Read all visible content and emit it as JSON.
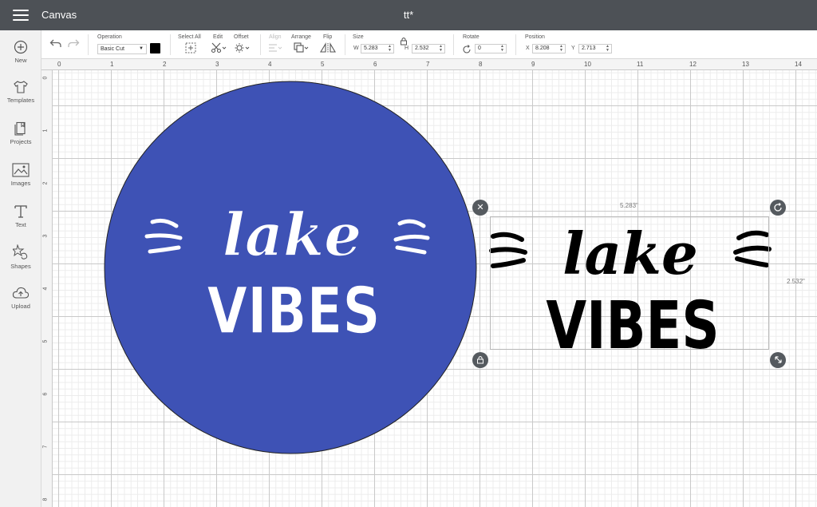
{
  "titlebar": {
    "app_title": "Canvas",
    "doc_title": "tt*"
  },
  "sidebar": {
    "items": [
      {
        "label": "New",
        "icon": "plus-circle-icon"
      },
      {
        "label": "Templates",
        "icon": "shirt-icon"
      },
      {
        "label": "Projects",
        "icon": "projects-icon"
      },
      {
        "label": "Images",
        "icon": "image-icon"
      },
      {
        "label": "Text",
        "icon": "text-icon"
      },
      {
        "label": "Shapes",
        "icon": "shapes-icon"
      },
      {
        "label": "Upload",
        "icon": "upload-icon"
      }
    ]
  },
  "toolbar": {
    "operation_label": "Operation",
    "operation_value": "Basic Cut",
    "operation_color": "#000000",
    "select_all_label": "Select All",
    "edit_label": "Edit",
    "offset_label": "Offset",
    "align_label": "Align",
    "arrange_label": "Arrange",
    "flip_label": "Flip",
    "size_label": "Size",
    "size_w_key": "W",
    "size_w": "5.283",
    "size_h_key": "H",
    "size_h": "2.532",
    "rotate_label": "Rotate",
    "rotate_value": "0",
    "position_label": "Position",
    "pos_x_key": "X",
    "pos_x": "8.208",
    "pos_y_key": "Y",
    "pos_y": "2.713"
  },
  "ruler": {
    "top": [
      "0",
      "1",
      "2",
      "3",
      "4",
      "5",
      "6",
      "7",
      "8",
      "9",
      "10",
      "11",
      "12",
      "13",
      "14"
    ],
    "left": [
      "0",
      "1",
      "2",
      "3",
      "4",
      "5",
      "6",
      "7",
      "8"
    ]
  },
  "canvas": {
    "circle_color": "#3e52b5",
    "design_word_1": "lake",
    "design_word_2": "VIBES",
    "selection_width_label": "5.283\"",
    "selection_height_label": "2.532\""
  }
}
